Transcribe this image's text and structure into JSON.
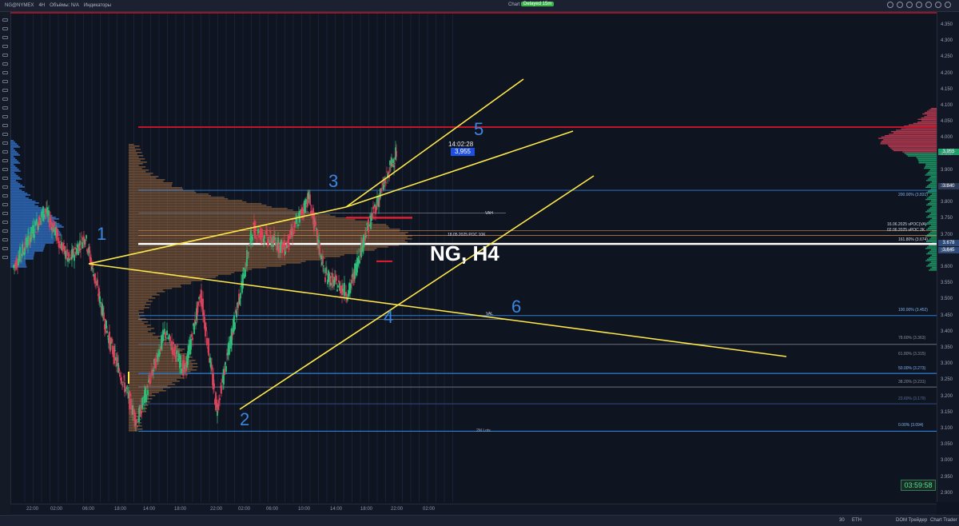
{
  "topbar": {
    "symbol": "NG@NYMEX",
    "interval": "4H",
    "volume": "Объёмы: N/A",
    "indicators": "Индикаторы",
    "chart_label": "Chart",
    "delayed": "Delayed 15m"
  },
  "chart": {
    "title": "NG, H4",
    "price_label": "3,955",
    "clock": "14:02:28",
    "timer": "03:59:58",
    "wave_labels": [
      "1",
      "2",
      "3",
      "4",
      "5",
      "6"
    ],
    "levels": {
      "vah": "VAH",
      "val": "VAL",
      "poc": "18.05.2025 POC 10K",
      "vpoc1": "16.06.2025 vPOC(VA)",
      "vpoc2": "02.06.2025 vPOC 2K",
      "fib_1618": "161.80% (3.674)",
      "fib_200": "200.00% (3.831)",
      "fib_100": "100.00% (3.452)",
      "fib_786": "78.60% (3.363)",
      "fib_618": "61.80% (3.315)",
      "fib_50": "50.00% (3.273)",
      "fib_382": "38.20% (3.231)",
      "fib_236": "23.60% (3.179)",
      "fib_0": "0.00% (3.094)",
      "lots": "2M Lots"
    }
  },
  "yaxis": {
    "labels": [
      "4.350",
      "4.300",
      "4.250",
      "4.200",
      "4.150",
      "4.100",
      "4.050",
      "4.000",
      "3.950",
      "3.900",
      "3.850",
      "3.800",
      "3.750",
      "3.700",
      "3.650",
      "3.600",
      "3.550",
      "3.500",
      "3.450",
      "3.400",
      "3.350",
      "3.300",
      "3.250",
      "3.200",
      "3.150",
      "3.100",
      "3.050",
      "3.000",
      "2.950",
      "2.900"
    ],
    "tag_current": "3.955",
    "tag_a": "3.840",
    "tag_b": "3.678",
    "tag_c": "3.645"
  },
  "xaxis": {
    "labels": [
      "22:00",
      "02:00",
      "06:00",
      "18:00",
      "14:00",
      "18:00",
      "22:00",
      "02:00",
      "06:00",
      "10:00",
      "14:00",
      "18:00",
      "22:00",
      "02:00"
    ]
  },
  "statusbar": {
    "zoom": "30",
    "session": "ETH",
    "dom": "DOM Трейдер",
    "trader": "Chart Trader"
  },
  "colors": {
    "background": "#0f1421",
    "profile": "#b87a45",
    "profile_blue": "#2f6fc2",
    "trend": "#ffe94a",
    "fib": "#2e7fd8",
    "resistance": "#c0162a"
  }
}
